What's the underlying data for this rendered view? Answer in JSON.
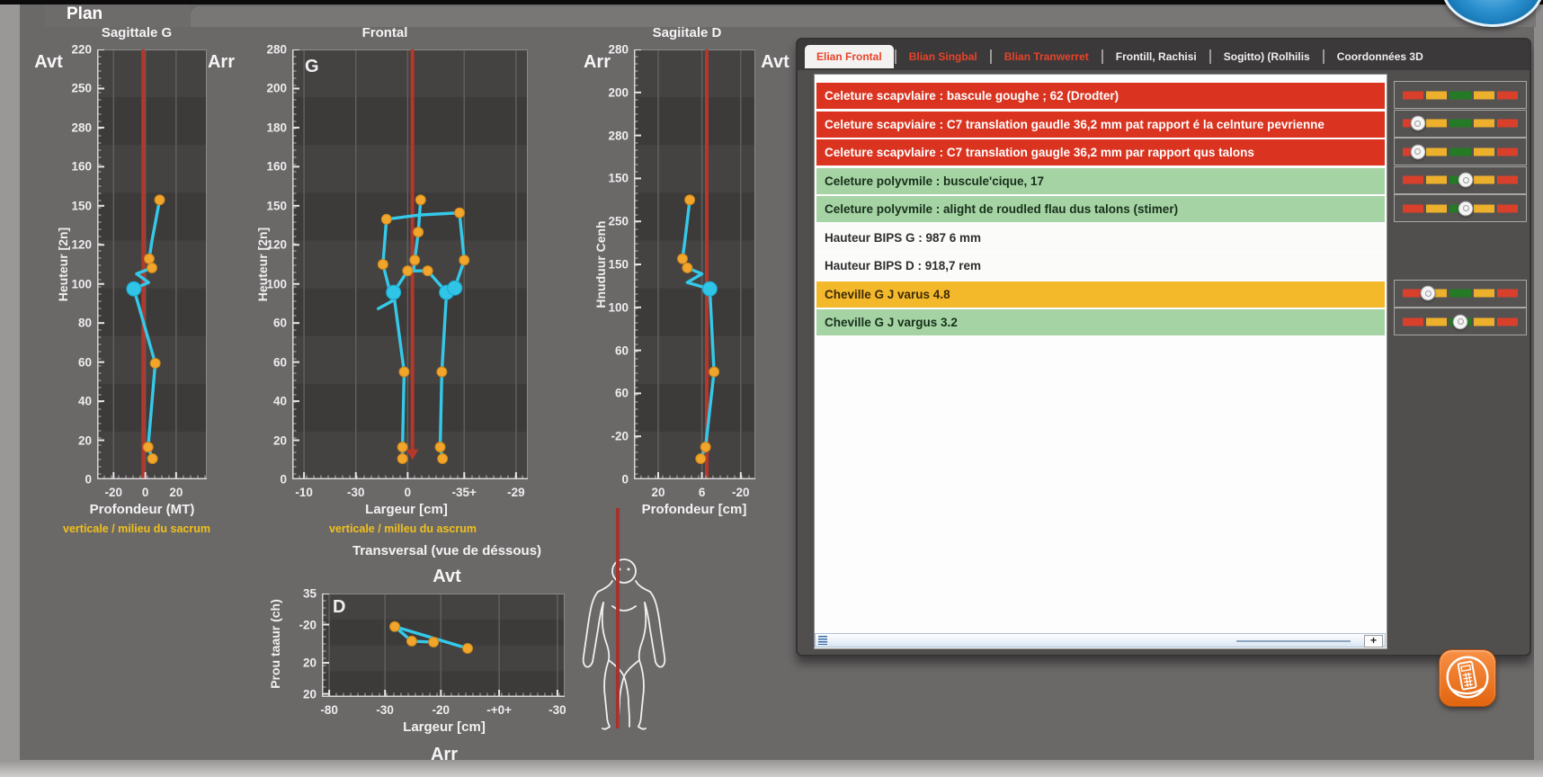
{
  "window": {
    "plan_tab_label": "Plan"
  },
  "colors": {
    "cyan_line": "#35c9e9",
    "joint_orange": "#f2a52b",
    "reference_red": "#b4372b",
    "note_yellow": "#f0c11c",
    "row_red": "#da3420",
    "row_green": "#a5d3a4",
    "row_yellow": "#f4b82b",
    "tab_red": "#e8432a"
  },
  "icons": {
    "calculator": "calculator-icon",
    "scrollbar_grip": "grip-icon",
    "app_logo": "blue-sphere-logo",
    "body": "body-silhouette"
  },
  "chart_data": [
    {
      "id": "sagittale_g",
      "type": "scatter",
      "title": "Sagittale G",
      "left_label": "Avt",
      "right_label": "Arr",
      "y_label": "Heuteur [2n]",
      "x_label": "Profondeur (MT)",
      "note": "verticale / milieu du sacrum",
      "y_ticks": [
        "220",
        "250",
        "280",
        "160",
        "150",
        "120",
        "100",
        "80",
        "60",
        "40",
        "20",
        "0"
      ],
      "x_ticks": [
        {
          "label": "-20",
          "f": 0.15
        },
        {
          "label": "0",
          "f": 0.44
        },
        {
          "label": "20",
          "f": 0.72
        }
      ],
      "red_line_f": 0.42,
      "red_arrow": false,
      "polylines": [
        [
          [
            0.57,
            0.35
          ],
          [
            0.5,
            0.445
          ],
          [
            0.475,
            0.487
          ],
          [
            0.5,
            0.508
          ],
          [
            0.36,
            0.522
          ],
          [
            0.47,
            0.542
          ],
          [
            0.335,
            0.557
          ],
          [
            0.53,
            0.73
          ],
          [
            0.465,
            0.925
          ],
          [
            0.505,
            0.952
          ]
        ]
      ],
      "dots": [
        [
          0.57,
          0.35
        ],
        [
          0.475,
          0.487
        ],
        [
          0.5,
          0.508
        ],
        [
          0.53,
          0.73
        ],
        [
          0.465,
          0.925
        ],
        [
          0.505,
          0.952
        ]
      ],
      "big_dots": [
        [
          0.335,
          0.557
        ]
      ]
    },
    {
      "id": "frontal",
      "type": "scatter",
      "title": "Frontal",
      "corner_label": "G",
      "y_label": "Heuteur [2n]",
      "x_label": "Largeur [cm]",
      "note": "verticale / milleu du ascrum",
      "y_ticks": [
        "280",
        "200",
        "180",
        "160",
        "150",
        "120",
        "100",
        "60",
        "60",
        "40",
        "20",
        "0"
      ],
      "x_ticks": [
        {
          "label": "-10",
          "f": 0.05
        },
        {
          "label": "-30",
          "f": 0.27
        },
        {
          "label": "0",
          "f": 0.49
        },
        {
          "label": "-35+",
          "f": 0.73
        },
        {
          "label": "-29",
          "f": 0.95
        }
      ],
      "red_line_f": 0.51,
      "red_arrow": true,
      "polylines": [
        [
          [
            0.545,
            0.35
          ],
          [
            0.535,
            0.425
          ],
          [
            0.52,
            0.49
          ],
          [
            0.515,
            0.515
          ]
        ],
        [
          [
            0.4,
            0.395
          ],
          [
            0.54,
            0.385
          ],
          [
            0.71,
            0.38
          ]
        ],
        [
          [
            0.4,
            0.395
          ],
          [
            0.385,
            0.5
          ],
          [
            0.425,
            0.585
          ],
          [
            0.365,
            0.603
          ]
        ],
        [
          [
            0.71,
            0.38
          ],
          [
            0.73,
            0.49
          ],
          [
            0.69,
            0.555
          ],
          [
            0.645,
            0.575
          ]
        ],
        [
          [
            0.43,
            0.565
          ],
          [
            0.49,
            0.515
          ],
          [
            0.575,
            0.515
          ],
          [
            0.655,
            0.565
          ]
        ],
        [
          [
            0.43,
            0.565
          ],
          [
            0.475,
            0.75
          ],
          [
            0.468,
            0.925
          ],
          [
            0.468,
            0.952
          ]
        ],
        [
          [
            0.655,
            0.565
          ],
          [
            0.635,
            0.75
          ],
          [
            0.628,
            0.925
          ],
          [
            0.638,
            0.952
          ]
        ]
      ],
      "dots": [
        [
          0.545,
          0.35
        ],
        [
          0.4,
          0.395
        ],
        [
          0.71,
          0.38
        ],
        [
          0.535,
          0.425
        ],
        [
          0.52,
          0.49
        ],
        [
          0.385,
          0.5
        ],
        [
          0.73,
          0.49
        ],
        [
          0.49,
          0.515
        ],
        [
          0.575,
          0.515
        ],
        [
          0.475,
          0.75
        ],
        [
          0.635,
          0.75
        ],
        [
          0.468,
          0.925
        ],
        [
          0.468,
          0.952
        ],
        [
          0.628,
          0.925
        ],
        [
          0.638,
          0.952
        ]
      ],
      "big_dots": [
        [
          0.43,
          0.565
        ],
        [
          0.655,
          0.565
        ],
        [
          0.69,
          0.555
        ]
      ]
    },
    {
      "id": "sagittale_d",
      "type": "scatter",
      "title": "Sagiitale D",
      "left_label": "Arr",
      "right_label": "Avt",
      "y_label": "Hnuduur Cenh",
      "x_label": "Profondeur [cm]",
      "y_ticks": [
        "280",
        "200",
        "280",
        "150",
        "250",
        "150",
        "100",
        "60",
        "60",
        "-20",
        "0"
      ],
      "x_ticks": [
        {
          "label": "20",
          "f": 0.2
        },
        {
          "label": "6",
          "f": 0.56
        },
        {
          "label": "-20",
          "f": 0.88
        }
      ],
      "red_line_f": 0.6,
      "red_arrow": false,
      "polylines": [
        [
          [
            0.46,
            0.35
          ],
          [
            0.42,
            0.445
          ],
          [
            0.4,
            0.487
          ],
          [
            0.44,
            0.508
          ],
          [
            0.56,
            0.522
          ],
          [
            0.44,
            0.542
          ],
          [
            0.625,
            0.557
          ],
          [
            0.66,
            0.75
          ],
          [
            0.59,
            0.925
          ],
          [
            0.55,
            0.952
          ]
        ]
      ],
      "dots": [
        [
          0.46,
          0.35
        ],
        [
          0.4,
          0.487
        ],
        [
          0.44,
          0.508
        ],
        [
          0.66,
          0.75
        ],
        [
          0.59,
          0.925
        ],
        [
          0.55,
          0.952
        ]
      ],
      "big_dots": [
        [
          0.625,
          0.557
        ]
      ]
    },
    {
      "id": "transversal",
      "type": "scatter",
      "title": "Transversal (vue de déssous)",
      "top_label": "Avt",
      "bottom_label": "Arr",
      "corner_label": "D",
      "y_label": "Prou taaur (ch)",
      "x_label": "Largeur [cm]",
      "y_ticks": [
        "35",
        "-20",
        "20",
        "20"
      ],
      "y_tick_fracs": [
        0,
        0.3,
        0.67,
        0.97
      ],
      "x_ticks": [
        {
          "label": "-80",
          "f": 0.03
        },
        {
          "label": "-30",
          "f": 0.26
        },
        {
          "label": "-20",
          "f": 0.49
        },
        {
          "label": "-+0+",
          "f": 0.73
        },
        {
          "label": "-30",
          "f": 0.97
        }
      ],
      "red_line_f": null,
      "red_arrow": false,
      "polylines": [
        [
          [
            0.3,
            0.32
          ],
          [
            0.37,
            0.46
          ],
          [
            0.46,
            0.47
          ]
        ],
        [
          [
            0.3,
            0.32
          ],
          [
            0.6,
            0.53
          ]
        ]
      ],
      "dots": [
        [
          0.3,
          0.32
        ],
        [
          0.37,
          0.46
        ],
        [
          0.46,
          0.47
        ],
        [
          0.6,
          0.53
        ]
      ],
      "big_dots": []
    }
  ],
  "panel": {
    "tabs": [
      {
        "label": "Elian Frontal",
        "active": true,
        "color": "red"
      },
      {
        "label": "Blian Singbal",
        "active": false,
        "color": "red"
      },
      {
        "label": "Blian Tranwerret",
        "active": false,
        "color": "red"
      },
      {
        "label": "Frontill, Rachisi",
        "active": false,
        "color": "white"
      },
      {
        "label": "Sogitto) (Rolhilis",
        "active": false,
        "color": "white"
      },
      {
        "label": "Coordonnées 3D",
        "active": false,
        "color": "white"
      }
    ],
    "gauge_segments": [
      "#d8402c",
      "#ecb02c",
      "#257a25",
      "#ecb02c",
      "#d8402c"
    ],
    "rows": [
      {
        "text": "Celeture scapvlaire : bascule goughe ; 62 (Drodter)",
        "status": "red",
        "gauge": {
          "show": true,
          "marker": null
        }
      },
      {
        "text": "Celeture scapviaire : C7 translation gaudle 36,2 mm pat rapport é la celnture pevrienne",
        "status": "red",
        "gauge": {
          "show": true,
          "marker": 0.13
        }
      },
      {
        "text": "Celeture scapvlaire : C7 translation gaugle 36,2 mm par rapport qus talons",
        "status": "red",
        "gauge": {
          "show": true,
          "marker": 0.13
        }
      },
      {
        "text": "Celeture polyvmile : buscule'cique, 17",
        "status": "green",
        "gauge": {
          "show": true,
          "marker": 0.55
        }
      },
      {
        "text": "Celeture polyvmile : alight de roudled flau dus talons (stimer)",
        "status": "green",
        "gauge": {
          "show": true,
          "marker": 0.55
        }
      },
      {
        "text": "Hauteur BIPS G : 987 6 mm",
        "status": "white",
        "gauge": {
          "show": false,
          "marker": null
        }
      },
      {
        "text": "Hauteur BIPS D : 918,7 rem",
        "status": "white",
        "gauge": {
          "show": false,
          "marker": null
        }
      },
      {
        "text": "Cheville G J varus 4.8",
        "status": "yellow",
        "gauge": {
          "show": true,
          "marker": 0.22
        }
      },
      {
        "text": "Cheville G J vargus 3.2",
        "status": "green",
        "gauge": {
          "show": true,
          "marker": 0.5
        }
      }
    ],
    "scrollbar": {
      "plus_label": "+"
    }
  }
}
